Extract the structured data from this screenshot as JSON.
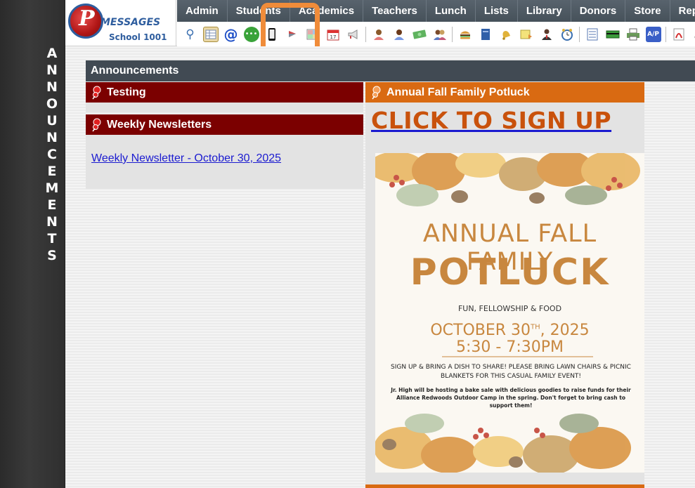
{
  "sidebar": {
    "vertical_title": [
      "A",
      "N",
      "N",
      "O",
      "U",
      "N",
      "C",
      "E",
      "M",
      "E",
      "N",
      "T",
      "S"
    ]
  },
  "logo": {
    "brand": "MESSAGES",
    "school": "School 1001"
  },
  "menu": [
    "Admin",
    "Students",
    "Academics",
    "Teachers",
    "Lunch",
    "Lists",
    "Library",
    "Donors",
    "Store",
    "Reports"
  ],
  "toolbar_icons": [
    "search-icon",
    "grid-icon",
    "email-icon",
    "chat-icon",
    "phone-icon",
    "flag-icon",
    "calendar-grid-icon",
    "calendar-icon",
    "megaphone-icon",
    "user-female-icon",
    "user-female-2-icon",
    "money-icon",
    "users-icon",
    "burger-icon",
    "book-icon",
    "bell-icon",
    "note-icon",
    "teacher-icon",
    "clock-icon",
    "list-icon",
    "card-icon",
    "printer-icon",
    "ap-icon",
    "pdf-icon",
    "tools-icon"
  ],
  "announcements": {
    "header": "Announcements",
    "cards": {
      "testing": {
        "title": "Testing"
      },
      "newsletters": {
        "title": "Weekly Newsletters",
        "link": "Weekly Newsletter - October 30, 2025"
      },
      "potluck": {
        "title": "Annual Fall Family Potluck",
        "signup": "CLICK TO SIGN UP"
      }
    }
  },
  "flyer": {
    "line1": "ANNUAL FALL FAMILY",
    "line2": "POTLUCK",
    "tagline": "FUN, FELLOWSHIP & FOOD",
    "date_prefix": "OCTOBER 30",
    "date_sup": "TH",
    "date_year": ", 2025",
    "time": "5:30 - 7:30PM",
    "invite": "SIGN UP & BRING A DISH TO SHARE! PLEASE BRING LAWN CHAIRS & PICNIC BLANKETS FOR THIS CASUAL FAMILY EVENT!",
    "bake_sale": "Jr. High will be hosting a bake sale with delicious goodies to raise funds for their Alliance Redwoods Outdoor Camp in the spring. Don't forget to bring cash to support them!"
  },
  "colors": {
    "menu_bg": "#4e5962",
    "card_dark_red": "#7b0000",
    "card_orange": "#d96a12",
    "highlight": "#f08c3a",
    "link": "#1b1bd0"
  }
}
